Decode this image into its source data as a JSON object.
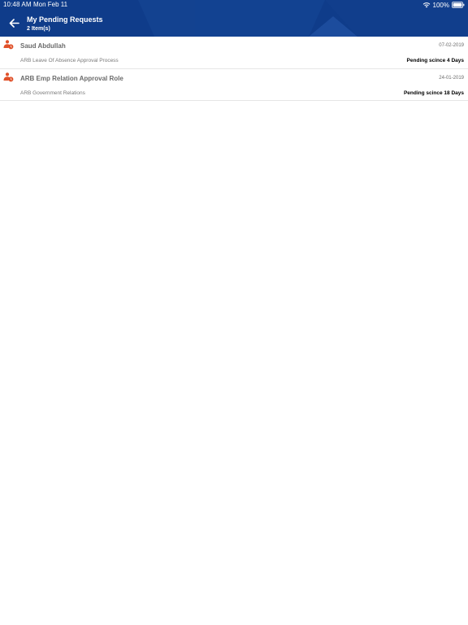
{
  "status_bar": {
    "time": "10:48 AM",
    "date": "Mon Feb 11",
    "battery": "100%"
  },
  "header": {
    "title": "My Pending Requests",
    "count": "2 Item(s)",
    "background": "#0f3c8a"
  },
  "requests": [
    {
      "title": "Saud Abdullah",
      "date": "07-02-2019",
      "subtitle": "ARB Leave Of Absence Approval Process",
      "status": "Pending scince 4 Days"
    },
    {
      "title": "ARB Emp Relation Approval Role",
      "date": "24-01-2019",
      "subtitle": "ARB Government Relations",
      "status": "Pending scince 18 Days"
    }
  ],
  "colors": {
    "accent_icon": "#e0512a"
  }
}
